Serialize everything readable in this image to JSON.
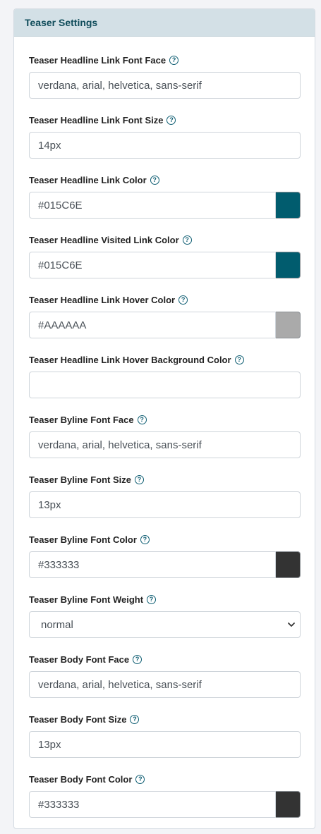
{
  "panel": {
    "title": "Teaser Settings"
  },
  "fields": {
    "headline_font_face": {
      "label": "Teaser Headline Link Font Face",
      "value": "verdana, arial, helvetica, sans-serif"
    },
    "headline_font_size": {
      "label": "Teaser Headline Link Font Size",
      "value": "14px"
    },
    "headline_link_color": {
      "label": "Teaser Headline Link Color",
      "value": "#015C6E",
      "swatch": "#015C6E"
    },
    "headline_visited_color": {
      "label": "Teaser Headline Visited Link Color",
      "value": "#015C6E",
      "swatch": "#015C6E"
    },
    "headline_hover_color": {
      "label": "Teaser Headline Link Hover Color",
      "value": "#AAAAAA",
      "swatch": "#AAAAAA"
    },
    "headline_hover_bg": {
      "label": "Teaser Headline Link Hover Background Color",
      "value": ""
    },
    "byline_font_face": {
      "label": "Teaser Byline Font Face",
      "value": "verdana, arial, helvetica, sans-serif"
    },
    "byline_font_size": {
      "label": "Teaser Byline Font Size",
      "value": "13px"
    },
    "byline_font_color": {
      "label": "Teaser Byline Font Color",
      "value": "#333333",
      "swatch": "#333333"
    },
    "byline_font_weight": {
      "label": "Teaser Byline Font Weight",
      "value": "normal"
    },
    "body_font_face": {
      "label": "Teaser Body Font Face",
      "value": "verdana, arial, helvetica, sans-serif"
    },
    "body_font_size": {
      "label": "Teaser Body Font Size",
      "value": "13px"
    },
    "body_font_color": {
      "label": "Teaser Body Font Color",
      "value": "#333333",
      "swatch": "#333333"
    }
  },
  "icons": {
    "help": "question-circle-icon",
    "select_arrow": "chevron-down-icon"
  }
}
